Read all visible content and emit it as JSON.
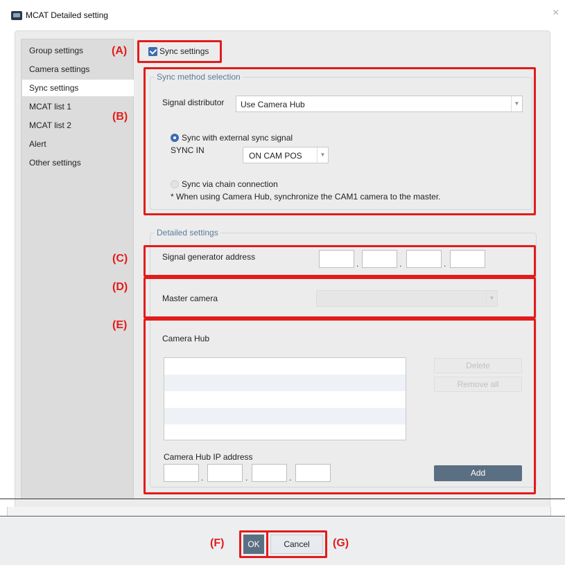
{
  "window": {
    "title": "MCAT Detailed setting",
    "close_glyph": "×"
  },
  "sidebar": {
    "items": [
      {
        "label": "Group settings",
        "active": false
      },
      {
        "label": "Camera settings",
        "active": false
      },
      {
        "label": "Sync settings",
        "active": true
      },
      {
        "label": "MCAT list 1",
        "active": false
      },
      {
        "label": "MCAT list 2",
        "active": false
      },
      {
        "label": "Alert",
        "active": false
      },
      {
        "label": "Other settings",
        "active": false
      }
    ]
  },
  "annotations": {
    "a": "(A)",
    "b": "(B)",
    "c": "(C)",
    "d": "(D)",
    "e": "(E)",
    "f": "(F)",
    "g": "(G)"
  },
  "sync": {
    "checkbox_label": "Sync settings",
    "checked": true,
    "method_group_title": "Sync method selection",
    "signal_distributor_label": "Signal distributor",
    "signal_distributor_value": "Use Camera Hub",
    "radio_external_label": "Sync with external sync signal",
    "sync_in_label": "SYNC IN",
    "sync_in_value": "ON CAM POS",
    "radio_chain_label": "Sync via chain connection",
    "note": "* When using Camera Hub, synchronize the CAM1 camera to the master."
  },
  "detailed": {
    "group_title": "Detailed settings",
    "signal_generator_label": "Signal generator address",
    "master_camera_label": "Master camera",
    "master_camera_value": "",
    "camera_hub_label": "Camera Hub",
    "camera_hub_list": [],
    "delete_label": "Delete",
    "remove_all_label": "Remove all",
    "camera_hub_ip_label": "Camera Hub IP address",
    "add_label": "Add",
    "ip_separator": "."
  },
  "footer": {
    "ok_label": "OK",
    "cancel_label": "Cancel"
  },
  "colors": {
    "annotation": "#e31b1b",
    "accent": "#3d6bb0",
    "primary_button": "#5b6f82"
  }
}
